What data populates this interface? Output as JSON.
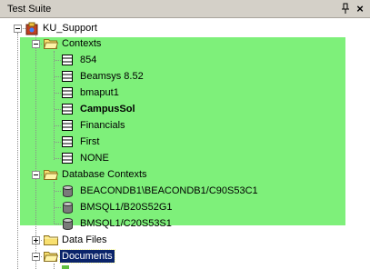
{
  "panel": {
    "title": "Test Suite",
    "pin_icon": "pin-icon",
    "close_label": "×"
  },
  "colors": {
    "highlight": "#7ef07a",
    "selection": "#0a246a",
    "titlebar": "#d4d0c8"
  },
  "tree": {
    "root": {
      "label": "KU_Support",
      "icon": "project-icon"
    },
    "contexts": {
      "label": "Contexts",
      "items": [
        "854",
        "Beamsys 8.52",
        "bmaput1",
        "CampusSol",
        "Financials",
        "First",
        "NONE"
      ],
      "bold_item": "CampusSol"
    },
    "database_contexts": {
      "label": "Database Contexts",
      "items": [
        "BEACONDB1\\BEACONDB1/C90S53C1",
        "BMSQL1/B20S52G1",
        "BMSQL1/C20S53S1"
      ]
    },
    "data_files": {
      "label": "Data Files"
    },
    "documents": {
      "label": "Documents"
    }
  }
}
